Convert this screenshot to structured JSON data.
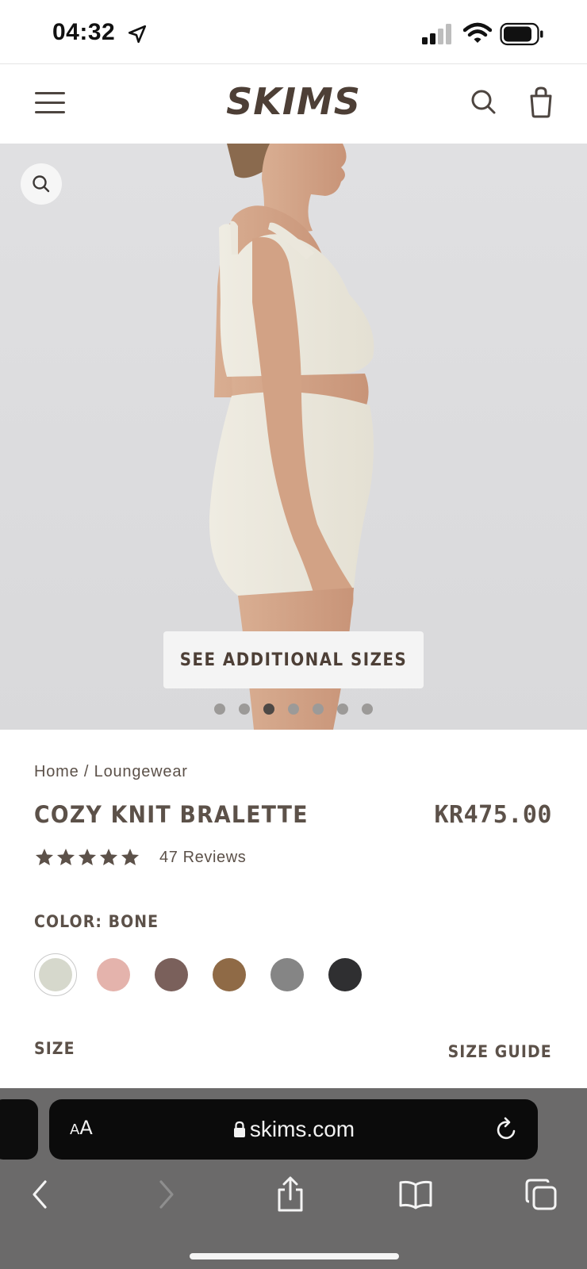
{
  "status_bar": {
    "time": "04:32",
    "icons": [
      "location-arrow-icon",
      "cellular-signal-icon",
      "wifi-icon",
      "battery-icon"
    ]
  },
  "header": {
    "logo": "SKIMS",
    "icons": [
      "hamburger-menu-icon",
      "search-icon",
      "shopping-bag-icon"
    ]
  },
  "gallery": {
    "zoom_icon": "magnify-icon",
    "additional_sizes_label": "SEE ADDITIONAL SIZES",
    "slide_count": 7,
    "active_slide": 3
  },
  "breadcrumb": {
    "home": "Home",
    "separator": " / ",
    "category": "Loungewear"
  },
  "product": {
    "title": "COZY KNIT BRALETTE",
    "price": "KR475.00",
    "rating": 5,
    "reviews": "47 Reviews"
  },
  "color": {
    "label": "COLOR: BONE",
    "swatches": [
      {
        "name": "bone",
        "hex": "#d6d8cc",
        "selected": true
      },
      {
        "name": "rose",
        "hex": "#e4b3ac",
        "selected": false
      },
      {
        "name": "mauve-brown",
        "hex": "#7a605b",
        "selected": false
      },
      {
        "name": "camel",
        "hex": "#8f6a46",
        "selected": false
      },
      {
        "name": "heather-grey",
        "hex": "#858585",
        "selected": false
      },
      {
        "name": "onyx",
        "hex": "#2f2f31",
        "selected": false
      }
    ]
  },
  "size": {
    "label": "SIZE",
    "guide_label": "SIZE GUIDE"
  },
  "browser": {
    "text_size_small": "A",
    "text_size_big": "A",
    "url": "skims.com",
    "toolbar_icons": [
      "back-icon",
      "forward-icon",
      "share-icon",
      "bookmarks-icon",
      "tabs-icon"
    ]
  },
  "colors": {
    "text_brown": "#5c5149",
    "logo_brown": "#4d3f36",
    "browser_bg": "#6b6a6a"
  }
}
